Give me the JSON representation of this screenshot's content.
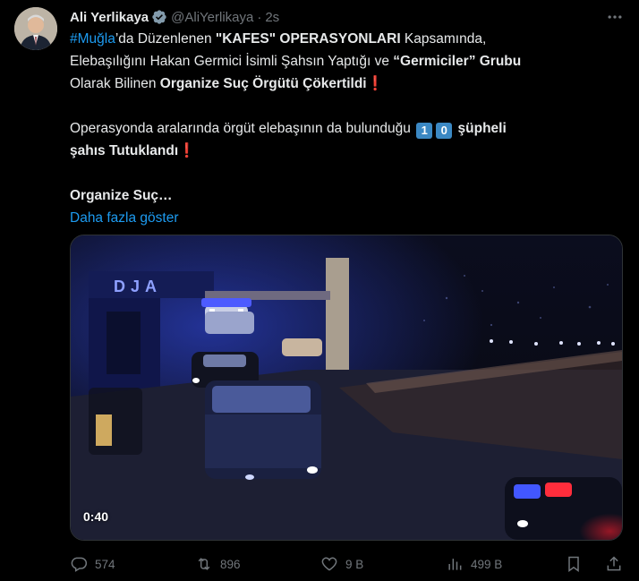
{
  "tweet": {
    "author_name": "Ali Yerlikaya",
    "handle": "@AliYerlikaya",
    "separator": "·",
    "time": "2s",
    "text": {
      "hashtag": "#Muğla",
      "l1_a": "’da Düzenlenen ",
      "l1_b": "\"KAFES\" OPERASYONLARI",
      "l1_c": " Kapsamında,",
      "l2_a": "Elebaşılığını Hakan Germici İsimli Şahsın Yaptığı ve ",
      "l2_b": "“Germiciler” Grubu",
      "l3_a": "Olarak Bilinen ",
      "l3_b": "Organize Suç Örgütü Çökertildi",
      "excl": "❗",
      "p2_a": "Operasyonda aralarında örgüt elebaşının da bulunduğu ",
      "key1": "1",
      "key0": "0",
      "p2_b": " şüpheli",
      "p2_c": "şahıs Tutuklandı",
      "p3": "Organize Suç…",
      "show_more": "Daha fazla göster"
    },
    "media": {
      "duration": "0:40",
      "sign_text": "DJA"
    },
    "actions": {
      "replies": "574",
      "reposts": "896",
      "likes": "9 B",
      "views": "499 B"
    }
  },
  "colors": {
    "background": "#000000",
    "text": "#e7e9ea",
    "muted": "#71767b",
    "link": "#1d9bf0",
    "verified": "#829aab",
    "alert": "#e0245e"
  },
  "icons": {
    "verified": "verified-badge-icon",
    "more": "more-dots-icon",
    "reply": "reply-icon",
    "repost": "repost-icon",
    "like": "heart-icon",
    "views": "views-chart-icon",
    "bookmark": "bookmark-icon",
    "share": "share-icon"
  }
}
